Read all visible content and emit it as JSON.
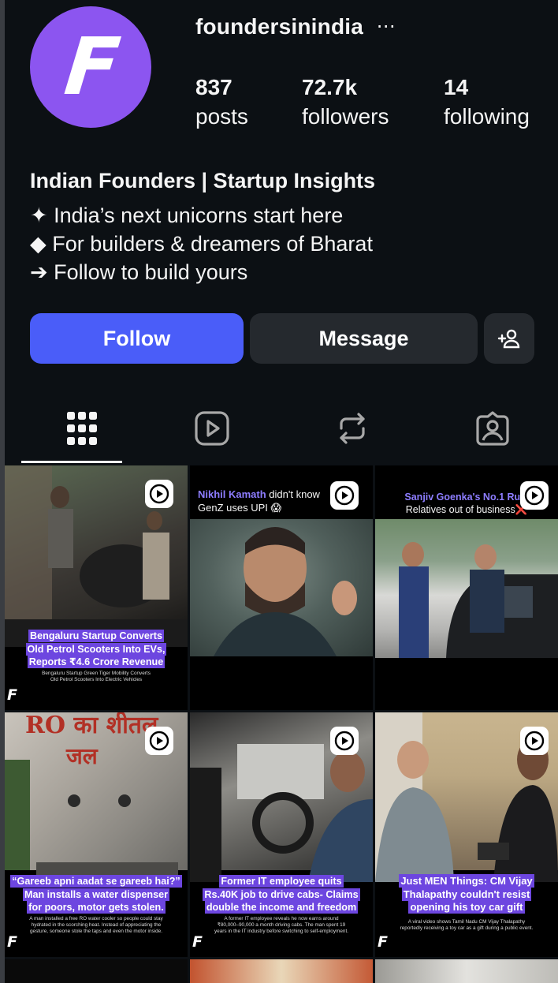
{
  "profile": {
    "username": "foundersinindia",
    "avatar_letter": "F",
    "more_icon": "⋯",
    "stats": {
      "posts": {
        "count": "837",
        "label": "posts"
      },
      "followers": {
        "count": "72.7k",
        "label": "followers"
      },
      "following": {
        "count": "14",
        "label": "following"
      }
    },
    "bio": {
      "name": "Indian Founders | Startup Insights",
      "lines": [
        "✦ India’s next unicorns start here",
        "◆ For builders & dreamers of Bharat",
        "➔ Follow to build yours"
      ]
    }
  },
  "actions": {
    "follow_label": "Follow",
    "message_label": "Message",
    "add_user_icon": "person-add-icon"
  },
  "tabs": [
    {
      "name": "posts",
      "icon": "grid-icon",
      "active": true
    },
    {
      "name": "reels",
      "icon": "reels-icon",
      "active": false
    },
    {
      "name": "reposts",
      "icon": "repost-icon",
      "active": false
    },
    {
      "name": "tagged",
      "icon": "tagged-icon",
      "active": false
    }
  ],
  "posts": [
    {
      "headline": [
        "Bengaluru Startup Converts",
        "Old Petrol Scooters Into EVs,",
        "Reports ₹4.6 Crore Revenue"
      ],
      "sub": [
        "Bengaluru Startup Green Tiger Mobility Converts",
        "Old Petrol Scooters Into Electric Vehicles"
      ]
    },
    {
      "caption_accent": "Nikhil Kamath",
      "caption_rest": " didn't know",
      "caption_line2": "GenZ uses UPI 😱"
    },
    {
      "caption_accent": "Sanjiv Goenka's No.1 Rule",
      "caption_line2": "Relatives out of business❌"
    },
    {
      "sign_text": "RO का शीतल",
      "sign_text2": "जल",
      "headline": [
        "“Gareeb apni aadat se gareeb hai?”",
        "Man installs a water dispenser",
        "for poors, motor gets stolen."
      ],
      "sub": [
        "A man installed a free RO water cooler so people could stay",
        "hydrated in the scorching heat. Instead of appreciating the",
        "gesture, someone stole the taps and even the motor inside."
      ]
    },
    {
      "headline": [
        "Former IT employee quits",
        "Rs.40K job to drive cabs- Claims",
        "double the income and freedom"
      ],
      "sub": [
        "A former IT employee reveals he now earns around",
        "₹80,000–90,000 a month driving cabs. The man spent 19",
        "years in the IT industry before switching to self-employment."
      ]
    },
    {
      "headline": [
        "Just MEN Things: CM Vijay",
        "Thalapathy couldn't resist",
        "opening his toy car gift"
      ],
      "sub": [
        "A viral video shows Tamil Nadu CM Vijay Thalapathy",
        "reportedly receiving a toy car as a gift during a public event."
      ]
    }
  ],
  "colors": {
    "background": "#0c1014",
    "follow_button": "#4a5df9",
    "secondary_button": "#25292e",
    "avatar": "#8c55f0",
    "headline_highlight": "#6d46e0",
    "caption_accent": "#8d7dff"
  }
}
